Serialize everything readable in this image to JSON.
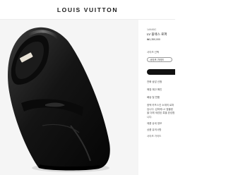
{
  "header": {
    "brand": "LOUIS VUITTON"
  },
  "gallery": {
    "image": "black-leather-loafer"
  },
  "product": {
    "ref": "1A9ABC",
    "name": "LV 플렉스 로퍼",
    "price": "₩1,350,000",
    "size_label": "사이즈 선택",
    "size_select": "사이즈 가이드",
    "buy_label": "",
    "links": [
      "전화 상담 신청",
      "매장 재고 확인",
      "배송 및 반품"
    ],
    "description": "광택 카프스킨 소재의 로퍼입니다. 갑피에 LV 엠블럼을 더해 세련된 룩을 완성합니다.",
    "details": [
      "제품 상세 정보",
      "상품 유의사항",
      "사이즈 가이드"
    ]
  }
}
